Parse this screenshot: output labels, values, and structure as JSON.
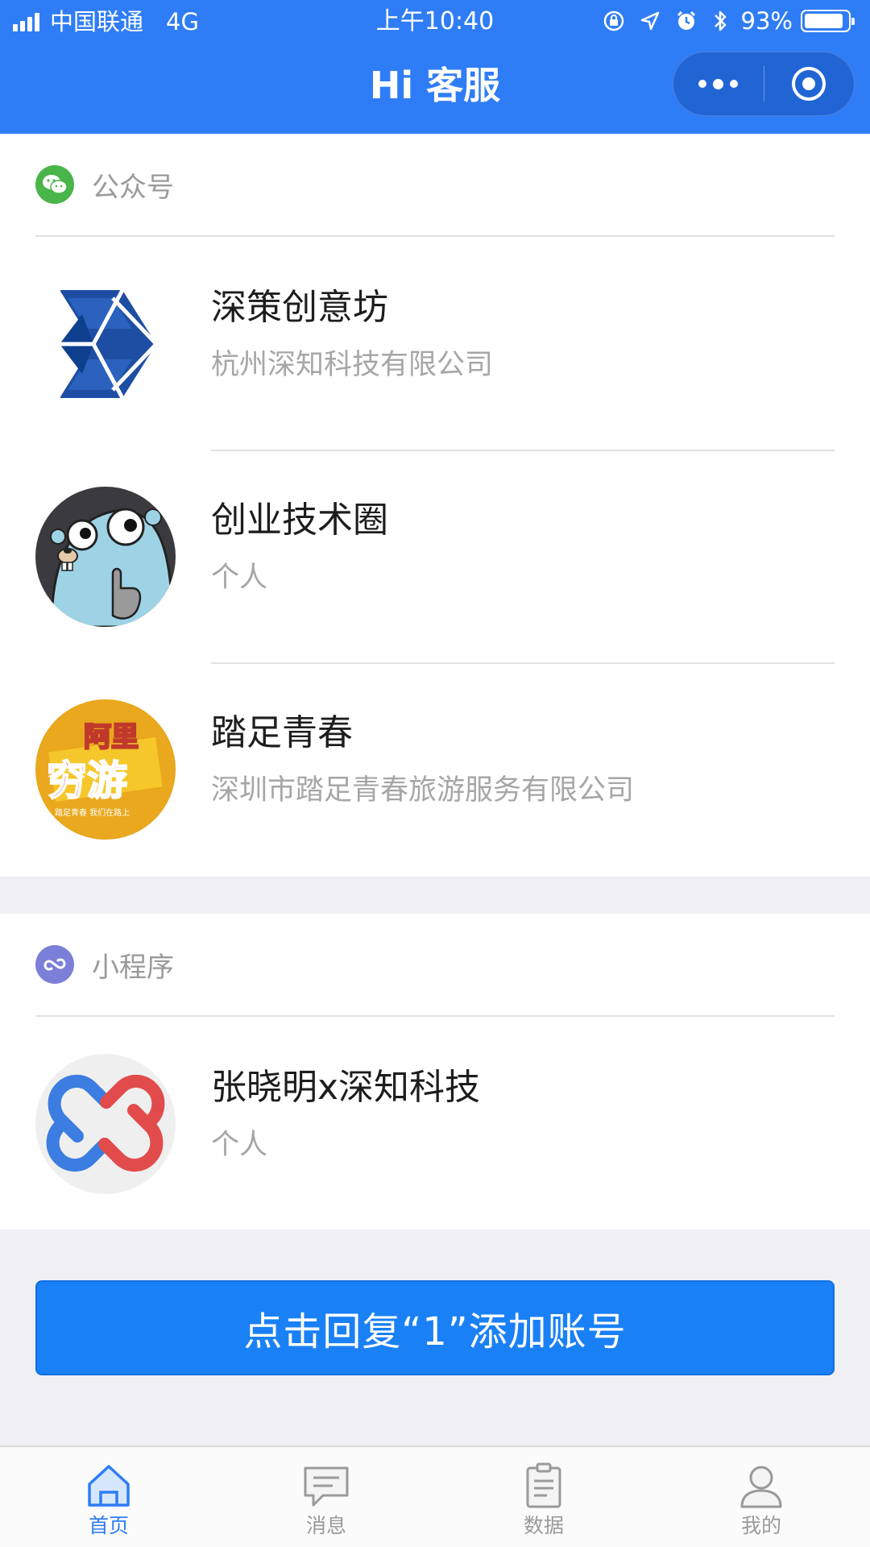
{
  "status_bar": {
    "carrier": "中国联通",
    "network": "4G",
    "time": "上午10:40",
    "battery": "93%",
    "battery_level": 0.93
  },
  "nav": {
    "title": "Hi 客服"
  },
  "colors": {
    "primary": "#2f7df6",
    "button": "#1a80f6",
    "wechat_green": "#4ab54a",
    "miniprogram_purple": "#7b7fd8"
  },
  "sections": [
    {
      "label": "公众号",
      "icon": "wechat-icon",
      "items": [
        {
          "title": "深策创意坊",
          "subtitle": "杭州深知科技有限公司",
          "avatar": "hexagon-logo"
        },
        {
          "title": "创业技术圈",
          "subtitle": "个人",
          "avatar": "gopher-cartoon"
        },
        {
          "title": "踏足青春",
          "subtitle": "深圳市踏足青春旅游服务有限公司",
          "avatar": "ali-qiongyou-logo",
          "avatar_text": "阿里穷游",
          "avatar_small_text": "踏足青春 我们在路上"
        }
      ]
    },
    {
      "label": "小程序",
      "icon": "miniprogram-icon",
      "items": [
        {
          "title": "张晓明x深知科技",
          "subtitle": "个人",
          "avatar": "chain-link-logo"
        }
      ]
    }
  ],
  "cta": {
    "label": "点击回复“1”添加账号"
  },
  "tabbar": [
    {
      "label": "首页",
      "icon": "home-icon",
      "active": true
    },
    {
      "label": "消息",
      "icon": "message-icon",
      "active": false
    },
    {
      "label": "数据",
      "icon": "clipboard-icon",
      "active": false
    },
    {
      "label": "我的",
      "icon": "user-icon",
      "active": false
    }
  ]
}
